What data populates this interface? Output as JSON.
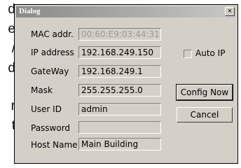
{
  "background_text": [
    "d",
    "e",
    "/",
    "d",
    "r",
    "t"
  ],
  "dialog": {
    "title": "Dialog",
    "close_label": "×",
    "fields": [
      {
        "label": "MAC addr.",
        "value": "00:60:E9:03:44:31",
        "disabled": true
      },
      {
        "label": "IP address",
        "value": "192.168.249.150"
      },
      {
        "label": "GateWay",
        "value": "192.168.249.1"
      },
      {
        "label": "Mask",
        "value": "255.255.255.0"
      },
      {
        "label": "User ID",
        "value": "admin"
      },
      {
        "label": "Password",
        "value": ""
      },
      {
        "label": "Host Name",
        "value": "Main Building"
      }
    ],
    "auto_ip_label": "Auto IP",
    "auto_ip_checked": false,
    "config_button": "Config Now",
    "cancel_button": "Cancel"
  }
}
